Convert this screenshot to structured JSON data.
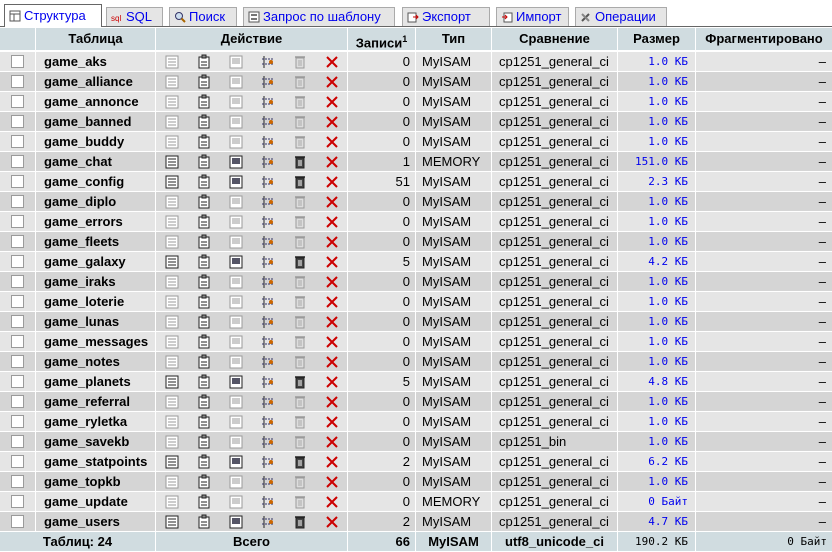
{
  "tabs": [
    {
      "label": "Структура",
      "icon": "structure-icon",
      "active": true
    },
    {
      "label": "SQL",
      "icon": "sql-icon",
      "active": false
    },
    {
      "label": "Поиск",
      "icon": "search-icon",
      "active": false
    },
    {
      "label": "Запрос по шаблону",
      "icon": "query-icon",
      "active": false
    },
    {
      "label": "Экспорт",
      "icon": "export-icon",
      "active": false
    },
    {
      "label": "Импорт",
      "icon": "import-icon",
      "active": false
    },
    {
      "label": "Операции",
      "icon": "operations-icon",
      "active": false
    }
  ],
  "headers": {
    "table": "Таблица",
    "action": "Действие",
    "records": "Записи",
    "records_sup": "1",
    "type": "Тип",
    "collation": "Сравнение",
    "size": "Размер",
    "overhead": "Фрагментировано"
  },
  "rows": [
    {
      "name": "game_aks",
      "records": "0",
      "type": "MyISAM",
      "collation": "cp1251_general_ci",
      "size": "1.0 КБ",
      "overhead": "–"
    },
    {
      "name": "game_alliance",
      "records": "0",
      "type": "MyISAM",
      "collation": "cp1251_general_ci",
      "size": "1.0 КБ",
      "overhead": "–"
    },
    {
      "name": "game_annonce",
      "records": "0",
      "type": "MyISAM",
      "collation": "cp1251_general_ci",
      "size": "1.0 КБ",
      "overhead": "–"
    },
    {
      "name": "game_banned",
      "records": "0",
      "type": "MyISAM",
      "collation": "cp1251_general_ci",
      "size": "1.0 КБ",
      "overhead": "–"
    },
    {
      "name": "game_buddy",
      "records": "0",
      "type": "MyISAM",
      "collation": "cp1251_general_ci",
      "size": "1.0 КБ",
      "overhead": "–"
    },
    {
      "name": "game_chat",
      "records": "1",
      "type": "MEMORY",
      "collation": "cp1251_general_ci",
      "size": "151.0 КБ",
      "overhead": "–"
    },
    {
      "name": "game_config",
      "records": "51",
      "type": "MyISAM",
      "collation": "cp1251_general_ci",
      "size": "2.3 КБ",
      "overhead": "–"
    },
    {
      "name": "game_diplo",
      "records": "0",
      "type": "MyISAM",
      "collation": "cp1251_general_ci",
      "size": "1.0 КБ",
      "overhead": "–"
    },
    {
      "name": "game_errors",
      "records": "0",
      "type": "MyISAM",
      "collation": "cp1251_general_ci",
      "size": "1.0 КБ",
      "overhead": "–"
    },
    {
      "name": "game_fleets",
      "records": "0",
      "type": "MyISAM",
      "collation": "cp1251_general_ci",
      "size": "1.0 КБ",
      "overhead": "–"
    },
    {
      "name": "game_galaxy",
      "records": "5",
      "type": "MyISAM",
      "collation": "cp1251_general_ci",
      "size": "4.2 КБ",
      "overhead": "–"
    },
    {
      "name": "game_iraks",
      "records": "0",
      "type": "MyISAM",
      "collation": "cp1251_general_ci",
      "size": "1.0 КБ",
      "overhead": "–"
    },
    {
      "name": "game_loterie",
      "records": "0",
      "type": "MyISAM",
      "collation": "cp1251_general_ci",
      "size": "1.0 КБ",
      "overhead": "–"
    },
    {
      "name": "game_lunas",
      "records": "0",
      "type": "MyISAM",
      "collation": "cp1251_general_ci",
      "size": "1.0 КБ",
      "overhead": "–"
    },
    {
      "name": "game_messages",
      "records": "0",
      "type": "MyISAM",
      "collation": "cp1251_general_ci",
      "size": "1.0 КБ",
      "overhead": "–"
    },
    {
      "name": "game_notes",
      "records": "0",
      "type": "MyISAM",
      "collation": "cp1251_general_ci",
      "size": "1.0 КБ",
      "overhead": "–"
    },
    {
      "name": "game_planets",
      "records": "5",
      "type": "MyISAM",
      "collation": "cp1251_general_ci",
      "size": "4.8 КБ",
      "overhead": "–"
    },
    {
      "name": "game_referral",
      "records": "0",
      "type": "MyISAM",
      "collation": "cp1251_general_ci",
      "size": "1.0 КБ",
      "overhead": "–"
    },
    {
      "name": "game_ryletka",
      "records": "0",
      "type": "MyISAM",
      "collation": "cp1251_general_ci",
      "size": "1.0 КБ",
      "overhead": "–"
    },
    {
      "name": "game_savekb",
      "records": "0",
      "type": "MyISAM",
      "collation": "cp1251_bin",
      "size": "1.0 КБ",
      "overhead": "–"
    },
    {
      "name": "game_statpoints",
      "records": "2",
      "type": "MyISAM",
      "collation": "cp1251_general_ci",
      "size": "6.2 КБ",
      "overhead": "–"
    },
    {
      "name": "game_topkb",
      "records": "0",
      "type": "MyISAM",
      "collation": "cp1251_general_ci",
      "size": "1.0 КБ",
      "overhead": "–"
    },
    {
      "name": "game_update",
      "records": "0",
      "type": "MEMORY",
      "collation": "cp1251_general_ci",
      "size": "0 Байт",
      "overhead": "–"
    },
    {
      "name": "game_users",
      "records": "2",
      "type": "MyISAM",
      "collation": "cp1251_general_ci",
      "size": "4.7 КБ",
      "overhead": "–"
    }
  ],
  "footer": {
    "tables": "Таблиц: 24",
    "action": "Всего",
    "records": "66",
    "type": "MyISAM",
    "collation": "utf8_unicode_ci",
    "size": "190.2 КБ",
    "overhead": "0 Байт"
  },
  "action_icons": [
    "browse-icon",
    "structure-icon",
    "search-icon",
    "insert-icon",
    "empty-icon",
    "drop-icon"
  ],
  "colors": {
    "header_bg": "#d0dce0",
    "row_even": "#e5e5e5",
    "row_odd": "#d5d5d5",
    "link": "#0000ee",
    "drop": "#cc0000"
  }
}
